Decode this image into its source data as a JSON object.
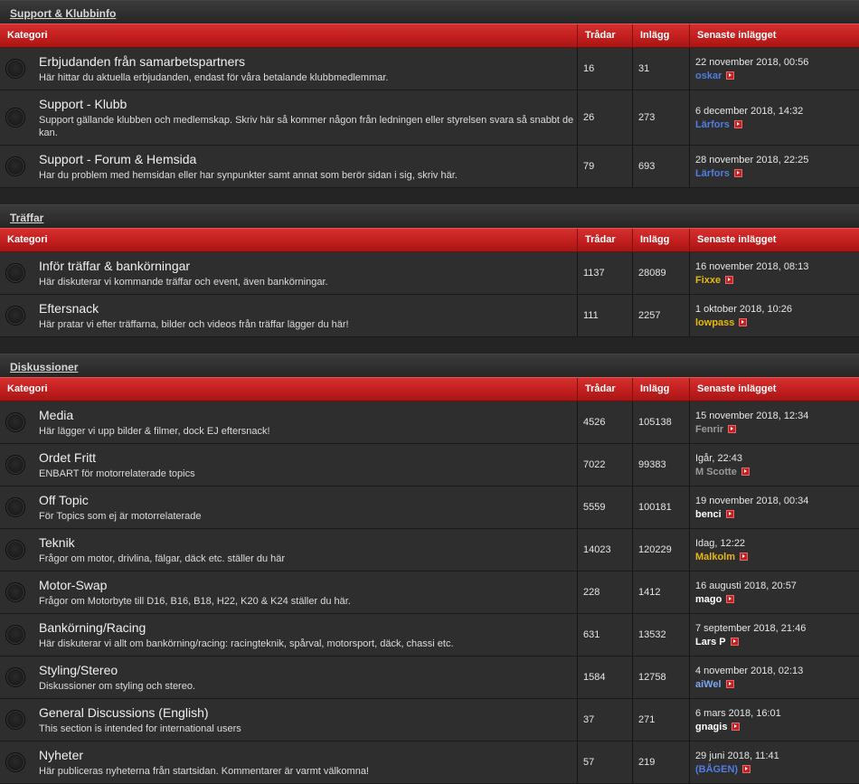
{
  "columns": {
    "category": "Kategori",
    "threads": "Trådar",
    "posts": "Inlägg",
    "last": "Senaste inlägget"
  },
  "colors": {
    "header_red": "#c21f1f",
    "author_blue": "#4f7de0",
    "author_gold": "#e8b80f",
    "author_gray": "#9a9a9a",
    "author_white": "#ffffff"
  },
  "sections": [
    {
      "title": "Support & Klubbinfo",
      "forums": [
        {
          "name": "Erbjudanden från samarbetspartners",
          "desc": "Här hittar du aktuella erbjudanden, endast för våra betalande klubbmedlemmar.",
          "threads": "16",
          "posts": "31",
          "last_date": "22 november 2018, 00:56",
          "last_author": "oskar",
          "author_color": "#4f7de0"
        },
        {
          "name": "Support - Klubb",
          "desc": "Support gällande klubben och medlemskap. Skriv här så kommer någon från ledningen eller styrelsen svara så snabbt de kan.",
          "threads": "26",
          "posts": "273",
          "last_date": "6 december 2018, 14:32",
          "last_author": "Lärfors",
          "author_color": "#4f7de0"
        },
        {
          "name": "Support - Forum & Hemsida",
          "desc": "Har du problem med hemsidan eller har synpunkter samt annat som berör sidan i sig, skriv här.",
          "threads": "79",
          "posts": "693",
          "last_date": "28 november 2018, 22:25",
          "last_author": "Lärfors",
          "author_color": "#4f7de0"
        }
      ]
    },
    {
      "title": "Träffar",
      "forums": [
        {
          "name": "Inför träffar & bankörningar",
          "desc": "Här diskuterar vi kommande träffar och event, även bankörningar.",
          "threads": "1137",
          "posts": "28089",
          "last_date": "16 november 2018, 08:13",
          "last_author": "Fixxe",
          "author_color": "#e8b80f"
        },
        {
          "name": "Eftersnack",
          "desc": "Här pratar vi efter träffarna, bilder och videos från träffar lägger du här!",
          "threads": "111",
          "posts": "2257",
          "last_date": "1 oktober 2018, 10:26",
          "last_author": "lowpass",
          "author_color": "#e8b80f"
        }
      ]
    },
    {
      "title": "Diskussioner",
      "forums": [
        {
          "name": "Media",
          "desc": "Här lägger vi upp bilder & filmer, dock EJ eftersnack!",
          "threads": "4526",
          "posts": "105138",
          "last_date": "15 november 2018, 12:34",
          "last_author": "Fenrir",
          "author_color": "#9a9a9a"
        },
        {
          "name": "Ordet Fritt",
          "desc": "ENBART för motorrelaterade topics",
          "threads": "7022",
          "posts": "99383",
          "last_date": "Igår, 22:43",
          "last_author": "M Scotte",
          "author_color": "#9a9a9a"
        },
        {
          "name": "Off Topic",
          "desc": "För Topics som ej är motorrelaterade",
          "threads": "5559",
          "posts": "100181",
          "last_date": "19 november 2018, 00:34",
          "last_author": "benci",
          "author_color": "#ffffff"
        },
        {
          "name": "Teknik",
          "desc": "Frågor om motor, drivlina, fälgar, däck etc. ställer du här",
          "threads": "14023",
          "posts": "120229",
          "last_date": "Idag, 12:22",
          "last_author": "Malkolm",
          "author_color": "#e8b80f"
        },
        {
          "name": "Motor-Swap",
          "desc": "Frågor om Motorbyte till D16, B16, B18, H22, K20 & K24 ställer du här.",
          "threads": "228",
          "posts": "1412",
          "last_date": "16 augusti 2018, 20:57",
          "last_author": "mago",
          "author_color": "#ffffff"
        },
        {
          "name": "Bankörning/Racing",
          "desc": "Här diskuterar vi allt om bankörning/racing: racingteknik, spårval, motorsport, däck, chassi etc.",
          "threads": "631",
          "posts": "13532",
          "last_date": "7 september 2018, 21:46",
          "last_author": "Lars P",
          "author_color": "#ffffff"
        },
        {
          "name": "Styling/Stereo",
          "desc": "Diskussioner om styling och stereo.",
          "threads": "1584",
          "posts": "12758",
          "last_date": "4 november 2018, 02:13",
          "last_author": "aiWel",
          "author_color": "#7aa7ef"
        },
        {
          "name": "General Discussions (English)",
          "desc": "This section is intended for international users",
          "threads": "37",
          "posts": "271",
          "last_date": "6 mars 2018, 16:01",
          "last_author": "gnagis",
          "author_color": "#ffffff"
        },
        {
          "name": "Nyheter",
          "desc": "Här publiceras nyheterna från startsidan. Kommentarer är varmt välkomna!",
          "threads": "57",
          "posts": "219",
          "last_date": "29 juni 2018, 11:41",
          "last_author": "(BÅGEN)",
          "author_color": "#4f7de0"
        }
      ]
    }
  ]
}
